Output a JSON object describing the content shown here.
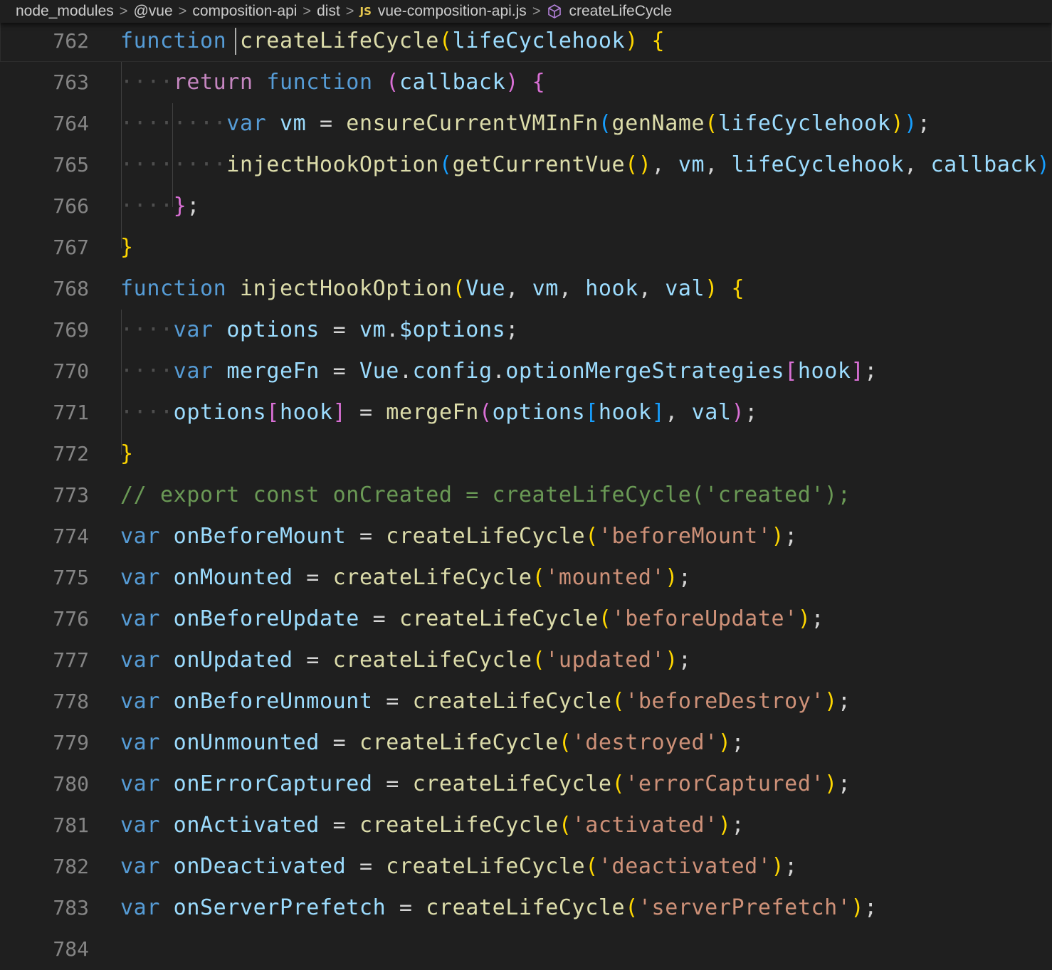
{
  "breadcrumb": {
    "items": [
      "node_modules",
      "@vue",
      "composition-api",
      "dist"
    ],
    "js_badge": "JS",
    "file": "vue-composition-api.js",
    "symbol": "createLifeCycle"
  },
  "colors": {
    "background": "#1f1f1f",
    "keyword": "#569cd6",
    "control": "#c586c0",
    "function": "#dcdcaa",
    "variable": "#9cdcfe",
    "string": "#ce9178",
    "comment": "#6a9955",
    "bracket1": "#ffd700",
    "bracket2": "#da70d6",
    "bracket3": "#179fff"
  },
  "lines": [
    {
      "n": "762",
      "t": [
        [
          "function",
          "kw"
        ],
        [
          " ",
          "p"
        ],
        [
          "createLifeCycle",
          "fn"
        ],
        [
          "(",
          "b1"
        ],
        [
          "lifeCyclehook",
          "var"
        ],
        [
          ")",
          "b1"
        ],
        [
          " ",
          "p"
        ],
        [
          "{",
          "b1"
        ]
      ]
    },
    {
      "n": "763",
      "t": [
        [
          "····",
          "ws"
        ],
        [
          "return",
          "ctl"
        ],
        [
          " ",
          "p"
        ],
        [
          "function",
          "kw"
        ],
        [
          " ",
          "p"
        ],
        [
          "(",
          "b2"
        ],
        [
          "callback",
          "var"
        ],
        [
          ")",
          "b2"
        ],
        [
          " ",
          "p"
        ],
        [
          "{",
          "b2"
        ]
      ]
    },
    {
      "n": "764",
      "t": [
        [
          "········",
          "ws"
        ],
        [
          "var",
          "kw"
        ],
        [
          " ",
          "p"
        ],
        [
          "vm",
          "var"
        ],
        [
          " = ",
          "p"
        ],
        [
          "ensureCurrentVMInFn",
          "fn"
        ],
        [
          "(",
          "b3"
        ],
        [
          "genName",
          "fn"
        ],
        [
          "(",
          "b1"
        ],
        [
          "lifeCyclehook",
          "var"
        ],
        [
          ")",
          "b1"
        ],
        [
          ")",
          "b3"
        ],
        [
          ";",
          "p"
        ]
      ]
    },
    {
      "n": "765",
      "t": [
        [
          "········",
          "ws"
        ],
        [
          "injectHookOption",
          "fn"
        ],
        [
          "(",
          "b3"
        ],
        [
          "getCurrentVue",
          "fn"
        ],
        [
          "(",
          "b1"
        ],
        [
          ")",
          "b1"
        ],
        [
          ", ",
          "p"
        ],
        [
          "vm",
          "var"
        ],
        [
          ", ",
          "p"
        ],
        [
          "lifeCyclehook",
          "var"
        ],
        [
          ", ",
          "p"
        ],
        [
          "callback",
          "var"
        ],
        [
          ")",
          "b3"
        ],
        [
          ";",
          "p"
        ]
      ]
    },
    {
      "n": "766",
      "t": [
        [
          "····",
          "ws"
        ],
        [
          "}",
          "b2"
        ],
        [
          ";",
          "p"
        ]
      ]
    },
    {
      "n": "767",
      "t": [
        [
          "}",
          "b1"
        ]
      ]
    },
    {
      "n": "768",
      "t": [
        [
          "function",
          "kw"
        ],
        [
          " ",
          "p"
        ],
        [
          "injectHookOption",
          "fn"
        ],
        [
          "(",
          "b1"
        ],
        [
          "Vue",
          "var"
        ],
        [
          ", ",
          "p"
        ],
        [
          "vm",
          "var"
        ],
        [
          ", ",
          "p"
        ],
        [
          "hook",
          "var"
        ],
        [
          ", ",
          "p"
        ],
        [
          "val",
          "var"
        ],
        [
          ")",
          "b1"
        ],
        [
          " ",
          "p"
        ],
        [
          "{",
          "b1"
        ]
      ]
    },
    {
      "n": "769",
      "t": [
        [
          "····",
          "ws"
        ],
        [
          "var",
          "kw"
        ],
        [
          " ",
          "p"
        ],
        [
          "options",
          "var"
        ],
        [
          " = ",
          "p"
        ],
        [
          "vm",
          "var"
        ],
        [
          ".",
          "p"
        ],
        [
          "$options",
          "var"
        ],
        [
          ";",
          "p"
        ]
      ]
    },
    {
      "n": "770",
      "t": [
        [
          "····",
          "ws"
        ],
        [
          "var",
          "kw"
        ],
        [
          " ",
          "p"
        ],
        [
          "mergeFn",
          "var"
        ],
        [
          " = ",
          "p"
        ],
        [
          "Vue",
          "var"
        ],
        [
          ".",
          "p"
        ],
        [
          "config",
          "var"
        ],
        [
          ".",
          "p"
        ],
        [
          "optionMergeStrategies",
          "var"
        ],
        [
          "[",
          "b2"
        ],
        [
          "hook",
          "var"
        ],
        [
          "]",
          "b2"
        ],
        [
          ";",
          "p"
        ]
      ]
    },
    {
      "n": "771",
      "t": [
        [
          "····",
          "ws"
        ],
        [
          "options",
          "var"
        ],
        [
          "[",
          "b2"
        ],
        [
          "hook",
          "var"
        ],
        [
          "]",
          "b2"
        ],
        [
          " = ",
          "p"
        ],
        [
          "mergeFn",
          "fn"
        ],
        [
          "(",
          "b2"
        ],
        [
          "options",
          "var"
        ],
        [
          "[",
          "b3"
        ],
        [
          "hook",
          "var"
        ],
        [
          "]",
          "b3"
        ],
        [
          ", ",
          "p"
        ],
        [
          "val",
          "var"
        ],
        [
          ")",
          "b2"
        ],
        [
          ";",
          "p"
        ]
      ]
    },
    {
      "n": "772",
      "t": [
        [
          "}",
          "b1"
        ]
      ]
    },
    {
      "n": "773",
      "t": [
        [
          "// export const onCreated = createLifeCycle('created');",
          "cmt"
        ]
      ]
    },
    {
      "n": "774",
      "t": [
        [
          "var",
          "kw"
        ],
        [
          " ",
          "p"
        ],
        [
          "onBeforeMount",
          "var"
        ],
        [
          " = ",
          "p"
        ],
        [
          "createLifeCycle",
          "fn"
        ],
        [
          "(",
          "b1"
        ],
        [
          "'beforeMount'",
          "str"
        ],
        [
          ")",
          "b1"
        ],
        [
          ";",
          "p"
        ]
      ]
    },
    {
      "n": "775",
      "t": [
        [
          "var",
          "kw"
        ],
        [
          " ",
          "p"
        ],
        [
          "onMounted",
          "var"
        ],
        [
          " = ",
          "p"
        ],
        [
          "createLifeCycle",
          "fn"
        ],
        [
          "(",
          "b1"
        ],
        [
          "'mounted'",
          "str"
        ],
        [
          ")",
          "b1"
        ],
        [
          ";",
          "p"
        ]
      ]
    },
    {
      "n": "776",
      "t": [
        [
          "var",
          "kw"
        ],
        [
          " ",
          "p"
        ],
        [
          "onBeforeUpdate",
          "var"
        ],
        [
          " = ",
          "p"
        ],
        [
          "createLifeCycle",
          "fn"
        ],
        [
          "(",
          "b1"
        ],
        [
          "'beforeUpdate'",
          "str"
        ],
        [
          ")",
          "b1"
        ],
        [
          ";",
          "p"
        ]
      ]
    },
    {
      "n": "777",
      "t": [
        [
          "var",
          "kw"
        ],
        [
          " ",
          "p"
        ],
        [
          "onUpdated",
          "var"
        ],
        [
          " = ",
          "p"
        ],
        [
          "createLifeCycle",
          "fn"
        ],
        [
          "(",
          "b1"
        ],
        [
          "'updated'",
          "str"
        ],
        [
          ")",
          "b1"
        ],
        [
          ";",
          "p"
        ]
      ]
    },
    {
      "n": "778",
      "t": [
        [
          "var",
          "kw"
        ],
        [
          " ",
          "p"
        ],
        [
          "onBeforeUnmount",
          "var"
        ],
        [
          " = ",
          "p"
        ],
        [
          "createLifeCycle",
          "fn"
        ],
        [
          "(",
          "b1"
        ],
        [
          "'beforeDestroy'",
          "str"
        ],
        [
          ")",
          "b1"
        ],
        [
          ";",
          "p"
        ]
      ]
    },
    {
      "n": "779",
      "t": [
        [
          "var",
          "kw"
        ],
        [
          " ",
          "p"
        ],
        [
          "onUnmounted",
          "var"
        ],
        [
          " = ",
          "p"
        ],
        [
          "createLifeCycle",
          "fn"
        ],
        [
          "(",
          "b1"
        ],
        [
          "'destroyed'",
          "str"
        ],
        [
          ")",
          "b1"
        ],
        [
          ";",
          "p"
        ]
      ]
    },
    {
      "n": "780",
      "t": [
        [
          "var",
          "kw"
        ],
        [
          " ",
          "p"
        ],
        [
          "onErrorCaptured",
          "var"
        ],
        [
          " = ",
          "p"
        ],
        [
          "createLifeCycle",
          "fn"
        ],
        [
          "(",
          "b1"
        ],
        [
          "'errorCaptured'",
          "str"
        ],
        [
          ")",
          "b1"
        ],
        [
          ";",
          "p"
        ]
      ]
    },
    {
      "n": "781",
      "t": [
        [
          "var",
          "kw"
        ],
        [
          " ",
          "p"
        ],
        [
          "onActivated",
          "var"
        ],
        [
          " = ",
          "p"
        ],
        [
          "createLifeCycle",
          "fn"
        ],
        [
          "(",
          "b1"
        ],
        [
          "'activated'",
          "str"
        ],
        [
          ")",
          "b1"
        ],
        [
          ";",
          "p"
        ]
      ]
    },
    {
      "n": "782",
      "t": [
        [
          "var",
          "kw"
        ],
        [
          " ",
          "p"
        ],
        [
          "onDeactivated",
          "var"
        ],
        [
          " = ",
          "p"
        ],
        [
          "createLifeCycle",
          "fn"
        ],
        [
          "(",
          "b1"
        ],
        [
          "'deactivated'",
          "str"
        ],
        [
          ")",
          "b1"
        ],
        [
          ";",
          "p"
        ]
      ]
    },
    {
      "n": "783",
      "t": [
        [
          "var",
          "kw"
        ],
        [
          " ",
          "p"
        ],
        [
          "onServerPrefetch",
          "var"
        ],
        [
          " = ",
          "p"
        ],
        [
          "createLifeCycle",
          "fn"
        ],
        [
          "(",
          "b1"
        ],
        [
          "'serverPrefetch'",
          "str"
        ],
        [
          ")",
          "b1"
        ],
        [
          ";",
          "p"
        ]
      ]
    },
    {
      "n": "784",
      "t": []
    }
  ]
}
